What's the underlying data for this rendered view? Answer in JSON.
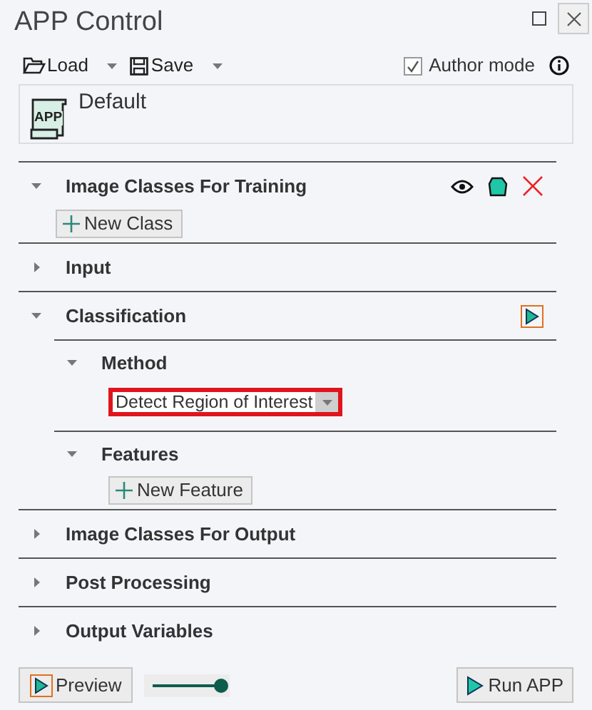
{
  "window": {
    "title": "APP Control"
  },
  "toolbar": {
    "load": "Load",
    "save": "Save",
    "author_mode": {
      "label": "Author mode",
      "checked": true
    }
  },
  "app": {
    "icon_text": "APP",
    "name": "Default"
  },
  "sections": [
    {
      "title": "Image Classes For Training",
      "expanded": true,
      "actions": [
        {
          "kind": "eye"
        },
        {
          "kind": "shape"
        },
        {
          "kind": "delete"
        }
      ],
      "children": [
        {
          "kind": "button",
          "label": "New Class"
        }
      ]
    },
    {
      "title": "Input",
      "expanded": false
    },
    {
      "title": "Classification",
      "expanded": true,
      "actions": [
        {
          "kind": "run"
        }
      ],
      "children": [
        {
          "kind": "subsection",
          "title": "Method",
          "expanded": true,
          "children": [
            {
              "kind": "dropdown",
              "value": "Detect Region of Interest"
            }
          ]
        },
        {
          "kind": "subsection",
          "title": "Features",
          "expanded": true,
          "children": [
            {
              "kind": "button",
              "label": "New Feature"
            }
          ]
        }
      ]
    },
    {
      "title": "Image Classes For Output",
      "expanded": false
    },
    {
      "title": "Post Processing",
      "expanded": false
    },
    {
      "title": "Output Variables",
      "expanded": false
    }
  ],
  "footer": {
    "preview": "Preview",
    "slider": {
      "level": 1
    },
    "run": "Run APP"
  }
}
